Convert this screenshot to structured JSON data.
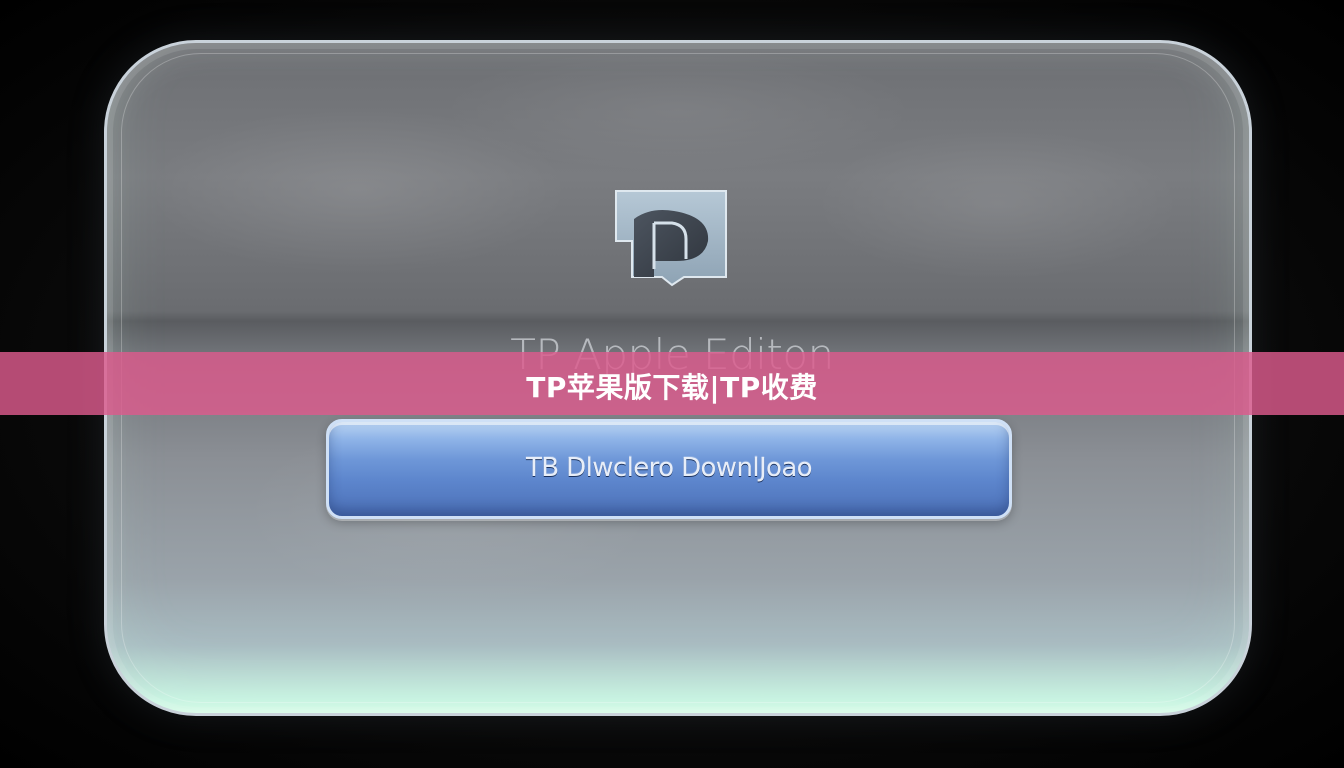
{
  "app": {
    "title": "TP Apple Editon",
    "logo_icon": "tp-logo-icon"
  },
  "actions": {
    "download_label": "TB Dlwclero DownlJoao"
  },
  "watermark": {
    "text": "TP苹果版下载|TP收费"
  },
  "colors": {
    "banner": "#dc5a8c",
    "button": "#6e97d8",
    "panel": "#6d6f73",
    "background": "#050505"
  }
}
